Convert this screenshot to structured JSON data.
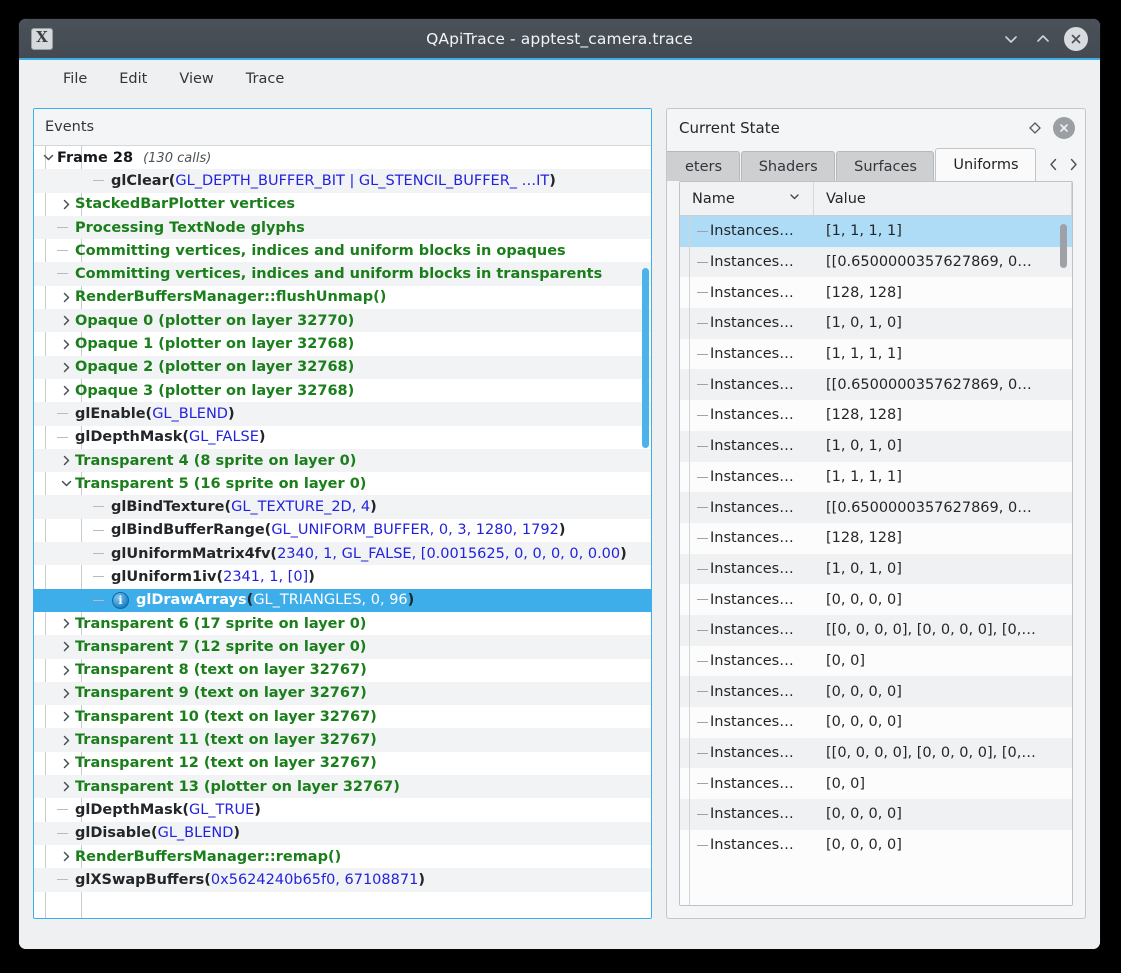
{
  "window": {
    "title": "QApiTrace - apptest_camera.trace",
    "app_icon": "X",
    "buttons": {
      "minimize": "chevron-down",
      "maximize": "chevron-up",
      "close": "close-circle"
    }
  },
  "menubar": {
    "items": [
      "File",
      "Edit",
      "View",
      "Trace"
    ]
  },
  "events": {
    "header": "Events",
    "rows": [
      {
        "depth": 0,
        "arrow": "down",
        "kind": "frame",
        "label": "Frame 28",
        "meta": "(130 calls)"
      },
      {
        "depth": 2,
        "arrow": "none",
        "kind": "call",
        "fn": "glClear",
        "args": "GL_DEPTH_BUFFER_BIT | GL_STENCIL_BUFFER_ …IT"
      },
      {
        "depth": 1,
        "arrow": "right",
        "kind": "group",
        "label": "StackedBarPlotter vertices"
      },
      {
        "depth": 1,
        "arrow": "none",
        "kind": "group",
        "label": "Processing TextNode glyphs"
      },
      {
        "depth": 1,
        "arrow": "none",
        "kind": "group",
        "label": "Committing vertices, indices and uniform blocks in opaques"
      },
      {
        "depth": 1,
        "arrow": "none",
        "kind": "group",
        "label": "Committing vertices, indices and uniform blocks in transparents"
      },
      {
        "depth": 1,
        "arrow": "right",
        "kind": "group",
        "label": "RenderBuffersManager::flushUnmap()"
      },
      {
        "depth": 1,
        "arrow": "right",
        "kind": "group",
        "label": "Opaque 0 (plotter on layer 32770)"
      },
      {
        "depth": 1,
        "arrow": "right",
        "kind": "group",
        "label": "Opaque 1 (plotter on layer 32768)"
      },
      {
        "depth": 1,
        "arrow": "right",
        "kind": "group",
        "label": "Opaque 2 (plotter on layer 32768)"
      },
      {
        "depth": 1,
        "arrow": "right",
        "kind": "group",
        "label": "Opaque 3 (plotter on layer 32768)"
      },
      {
        "depth": 1,
        "arrow": "none",
        "kind": "call",
        "fn": "glEnable",
        "args": "GL_BLEND"
      },
      {
        "depth": 1,
        "arrow": "none",
        "kind": "call",
        "fn": "glDepthMask",
        "args": "GL_FALSE"
      },
      {
        "depth": 1,
        "arrow": "right",
        "kind": "group",
        "label": "Transparent 4 (8 sprite on layer 0)"
      },
      {
        "depth": 1,
        "arrow": "down",
        "kind": "group",
        "label": "Transparent 5 (16 sprite on layer 0)"
      },
      {
        "depth": 2,
        "arrow": "none",
        "kind": "call",
        "fn": "glBindTexture",
        "args": "GL_TEXTURE_2D, 4"
      },
      {
        "depth": 2,
        "arrow": "none",
        "kind": "call",
        "fn": "glBindBufferRange",
        "args": "GL_UNIFORM_BUFFER, 0, 3, 1280, 1792"
      },
      {
        "depth": 2,
        "arrow": "none",
        "kind": "call",
        "fn": "glUniformMatrix4fv",
        "args": "2340, 1, GL_FALSE, [0.0015625, 0, 0, 0, 0, 0.00"
      },
      {
        "depth": 2,
        "arrow": "none",
        "kind": "call",
        "fn": "glUniform1iv",
        "args": "2341, 1, [0]"
      },
      {
        "depth": 2,
        "arrow": "none",
        "kind": "call",
        "icon": "info-icon",
        "selected": true,
        "fn": "glDrawArrays",
        "args": "GL_TRIANGLES, 0, 96"
      },
      {
        "depth": 1,
        "arrow": "right",
        "kind": "group",
        "label": "Transparent 6 (17 sprite on layer 0)"
      },
      {
        "depth": 1,
        "arrow": "right",
        "kind": "group",
        "label": "Transparent 7 (12 sprite on layer 0)"
      },
      {
        "depth": 1,
        "arrow": "right",
        "kind": "group",
        "label": "Transparent 8 (text on layer 32767)"
      },
      {
        "depth": 1,
        "arrow": "right",
        "kind": "group",
        "label": "Transparent 9 (text on layer 32767)"
      },
      {
        "depth": 1,
        "arrow": "right",
        "kind": "group",
        "label": "Transparent 10 (text on layer 32767)"
      },
      {
        "depth": 1,
        "arrow": "right",
        "kind": "group",
        "label": "Transparent 11 (text on layer 32767)"
      },
      {
        "depth": 1,
        "arrow": "right",
        "kind": "group",
        "label": "Transparent 12 (text on layer 32767)"
      },
      {
        "depth": 1,
        "arrow": "right",
        "kind": "group",
        "label": "Transparent 13 (plotter on layer 32767)"
      },
      {
        "depth": 1,
        "arrow": "none",
        "kind": "call",
        "fn": "glDepthMask",
        "args": "GL_TRUE"
      },
      {
        "depth": 1,
        "arrow": "none",
        "kind": "call",
        "fn": "glDisable",
        "args": "GL_BLEND"
      },
      {
        "depth": 1,
        "arrow": "right",
        "kind": "group",
        "label": "RenderBuffersManager::remap()"
      },
      {
        "depth": 1,
        "arrow": "none",
        "kind": "call",
        "fn": "glXSwapBuffers",
        "args": "0x5624240b65f0, 67108871"
      }
    ]
  },
  "dock": {
    "title": "Current State",
    "float_button": "float-icon",
    "close_button": "close-icon",
    "tabs": [
      {
        "label": "eters",
        "active": false,
        "partial": true
      },
      {
        "label": "Shaders",
        "active": false
      },
      {
        "label": "Surfaces",
        "active": false
      },
      {
        "label": "Uniforms",
        "active": true
      }
    ],
    "tab_nav": {
      "prev": "chevron-left-icon",
      "next": "chevron-right-icon"
    },
    "table": {
      "columns": [
        "Name",
        "Value"
      ],
      "sort_indicator": "chevron-down-icon",
      "rows": [
        {
          "name": "Instances…",
          "value": "[1, 1, 1, 1]",
          "selected": true
        },
        {
          "name": "Instances…",
          "value": "[[0.6500000357627869, 0…"
        },
        {
          "name": "Instances…",
          "value": "[128, 128]"
        },
        {
          "name": "Instances…",
          "value": "[1, 0, 1, 0]"
        },
        {
          "name": "Instances…",
          "value": "[1, 1, 1, 1]"
        },
        {
          "name": "Instances…",
          "value": "[[0.6500000357627869, 0…"
        },
        {
          "name": "Instances…",
          "value": "[128, 128]"
        },
        {
          "name": "Instances…",
          "value": "[1, 0, 1, 0]"
        },
        {
          "name": "Instances…",
          "value": "[1, 1, 1, 1]"
        },
        {
          "name": "Instances…",
          "value": "[[0.6500000357627869, 0…"
        },
        {
          "name": "Instances…",
          "value": "[128, 128]"
        },
        {
          "name": "Instances…",
          "value": "[1, 0, 1, 0]"
        },
        {
          "name": "Instances…",
          "value": "[0, 0, 0, 0]"
        },
        {
          "name": "Instances…",
          "value": "[[0, 0, 0, 0], [0, 0, 0, 0], [0,…"
        },
        {
          "name": "Instances…",
          "value": "[0, 0]"
        },
        {
          "name": "Instances…",
          "value": "[0, 0, 0, 0]"
        },
        {
          "name": "Instances…",
          "value": "[0, 0, 0, 0]"
        },
        {
          "name": "Instances…",
          "value": "[[0, 0, 0, 0], [0, 0, 0, 0], [0,…"
        },
        {
          "name": "Instances…",
          "value": "[0, 0]"
        },
        {
          "name": "Instances…",
          "value": "[0, 0, 0, 0]"
        },
        {
          "name": "Instances…",
          "value": "[0, 0, 0, 0]"
        }
      ]
    }
  },
  "colors": {
    "accent": "#3daee9",
    "group_text": "#1a7f1a",
    "arg_text": "#2222dd",
    "titlebar": "#434a52",
    "selection": "#3daee9",
    "table_selection": "#aedcf6"
  }
}
